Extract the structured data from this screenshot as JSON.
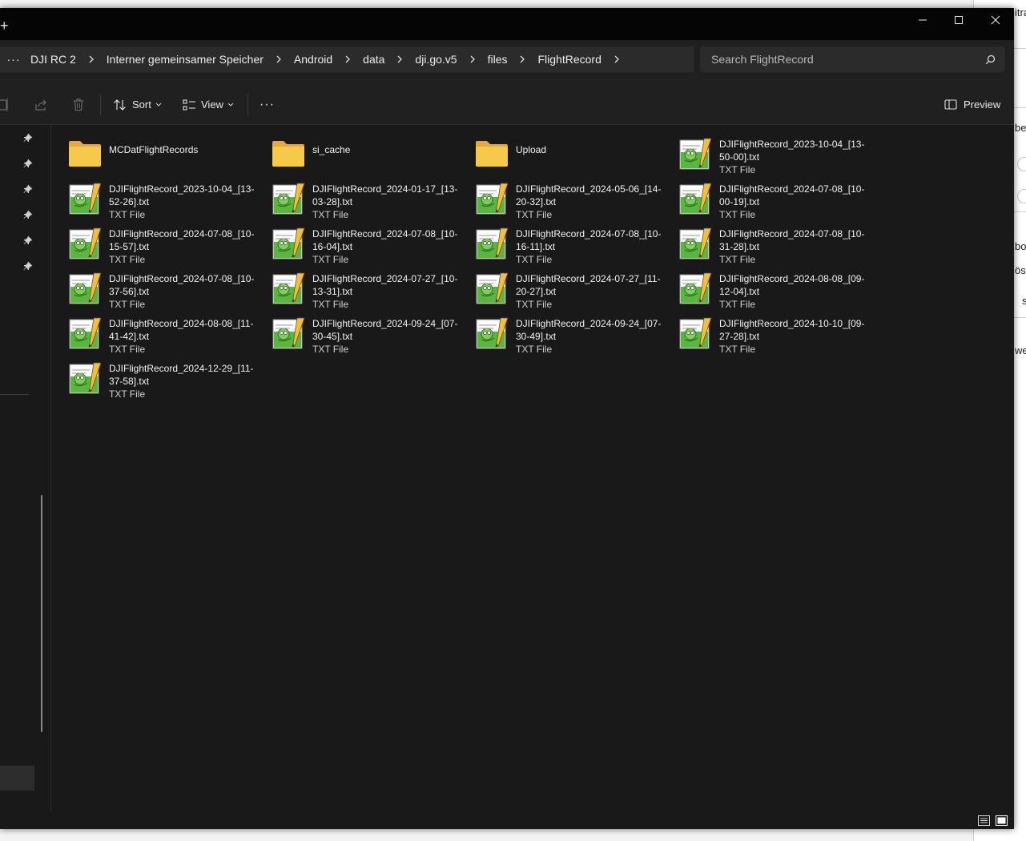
{
  "titlebar": {
    "new_tab": "+"
  },
  "window_controls": [
    "minimize-icon",
    "maximize-icon",
    "close-icon"
  ],
  "breadcrumb": {
    "more": "···",
    "items": [
      "DJI RC 2",
      "Interner gemeinsamer Speicher",
      "Android",
      "data",
      "dji.go.v5",
      "files",
      "FlightRecord"
    ]
  },
  "search": {
    "placeholder": "Search FlightRecord"
  },
  "toolbar": {
    "sort_label": "Sort",
    "view_label": "View",
    "more_label": "···",
    "preview_label": "Preview"
  },
  "files": [
    {
      "name": "MCDatFlightRecords",
      "kind": "folder",
      "type": ""
    },
    {
      "name": "si_cache",
      "kind": "folder",
      "type": ""
    },
    {
      "name": "Upload",
      "kind": "folder",
      "type": ""
    },
    {
      "name": "DJIFlightRecord_2023-10-04_[13-50-00].txt",
      "kind": "txt",
      "type": "TXT File"
    },
    {
      "name": "DJIFlightRecord_2023-10-04_[13-52-26].txt",
      "kind": "txt",
      "type": "TXT File"
    },
    {
      "name": "DJIFlightRecord_2024-01-17_[13-03-28].txt",
      "kind": "txt",
      "type": "TXT File"
    },
    {
      "name": "DJIFlightRecord_2024-05-06_[14-20-32].txt",
      "kind": "txt",
      "type": "TXT File"
    },
    {
      "name": "DJIFlightRecord_2024-07-08_[10-00-19].txt",
      "kind": "txt",
      "type": "TXT File"
    },
    {
      "name": "DJIFlightRecord_2024-07-08_[10-15-57].txt",
      "kind": "txt",
      "type": "TXT File"
    },
    {
      "name": "DJIFlightRecord_2024-07-08_[10-16-04].txt",
      "kind": "txt",
      "type": "TXT File"
    },
    {
      "name": "DJIFlightRecord_2024-07-08_[10-16-11].txt",
      "kind": "txt",
      "type": "TXT File"
    },
    {
      "name": "DJIFlightRecord_2024-07-08_[10-31-28].txt",
      "kind": "txt",
      "type": "TXT File"
    },
    {
      "name": "DJIFlightRecord_2024-07-08_[10-37-56].txt",
      "kind": "txt",
      "type": "TXT File"
    },
    {
      "name": "DJIFlightRecord_2024-07-27_[10-13-31].txt",
      "kind": "txt",
      "type": "TXT File"
    },
    {
      "name": "DJIFlightRecord_2024-07-27_[11-20-27].txt",
      "kind": "txt",
      "type": "TXT File"
    },
    {
      "name": "DJIFlightRecord_2024-08-08_[09-12-04].txt",
      "kind": "txt",
      "type": "TXT File"
    },
    {
      "name": "DJIFlightRecord_2024-08-08_[11-41-42].txt",
      "kind": "txt",
      "type": "TXT File"
    },
    {
      "name": "DJIFlightRecord_2024-09-24_[07-30-45].txt",
      "kind": "txt",
      "type": "TXT File"
    },
    {
      "name": "DJIFlightRecord_2024-09-24_[07-30-49].txt",
      "kind": "txt",
      "type": "TXT File"
    },
    {
      "name": "DJIFlightRecord_2024-10-10_[09-27-28].txt",
      "kind": "txt",
      "type": "TXT File"
    },
    {
      "name": "DJIFlightRecord_2024-12-29_[11-37-58].txt",
      "kind": "txt",
      "type": "TXT File"
    }
  ],
  "background_window": {
    "fragments": [
      "itra",
      "be",
      "bog",
      "öss",
      "s",
      "wei"
    ]
  },
  "colors": {
    "window_bg": "#191919",
    "titlebar_bg": "#050505",
    "folder_yellow": "#f7c948",
    "text": "#ffffff"
  }
}
